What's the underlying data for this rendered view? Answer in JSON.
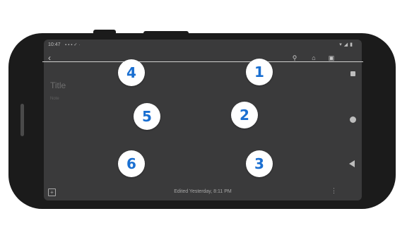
{
  "status_bar": {
    "time": "10:47",
    "left_icons": [
      "notification-icon",
      "message-icon",
      "cast-icon",
      "check-icon",
      "dot-icon"
    ],
    "right_icons": [
      "wifi-icon",
      "signal-icon",
      "battery-icon"
    ]
  },
  "toolbar": {
    "icons": [
      "back-arrow-icon",
      "pin-icon",
      "bell-icon",
      "archive-icon"
    ]
  },
  "note": {
    "title_placeholder": "Title",
    "body_placeholder": "Note"
  },
  "bottom_bar": {
    "edited_text": "Edited Yesterday, 8:11 PM",
    "icons": [
      "add-box-icon",
      "more-vert-icon"
    ]
  },
  "nav_bar": {
    "icons": [
      "recents-square-icon",
      "home-circle-icon",
      "back-triangle-icon"
    ]
  },
  "markers": {
    "one": "1",
    "two": "2",
    "three": "3",
    "four": "4",
    "five": "5",
    "six": "6"
  },
  "colors": {
    "phone_body": "#1b1b1b",
    "screen_bg": "#3a3a3b",
    "marker_bg": "#ffffff",
    "marker_text": "#1a6fd1"
  }
}
